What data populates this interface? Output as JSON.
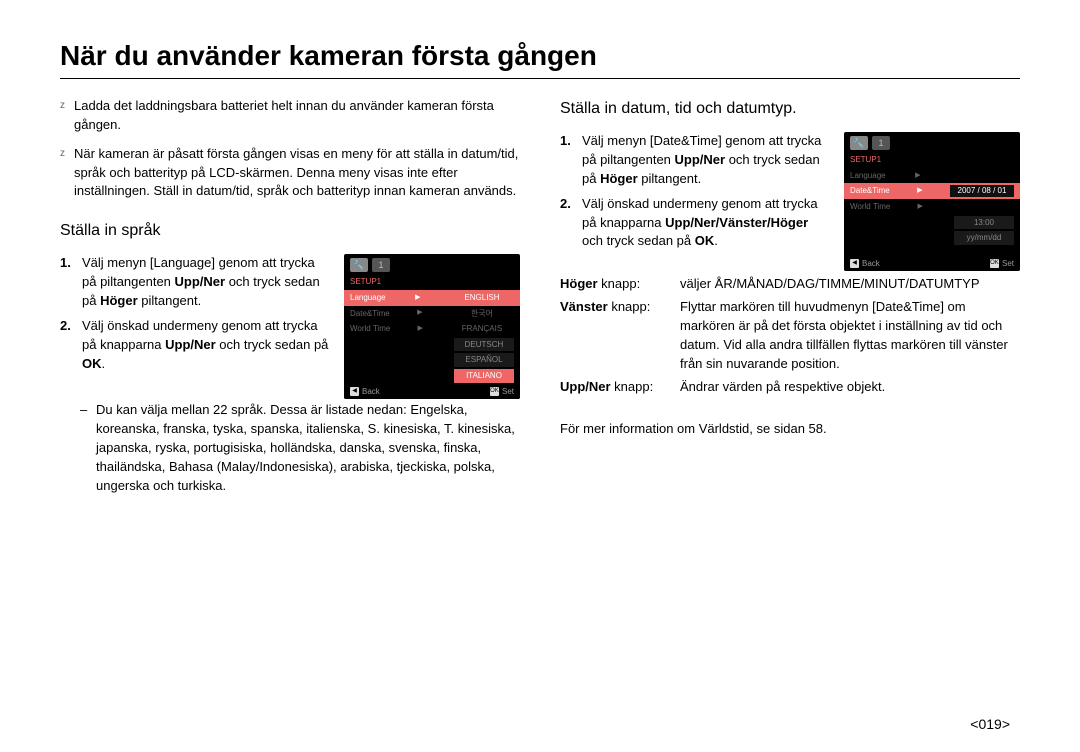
{
  "title": "När du använder kameran första gången",
  "left": {
    "leads": [
      "Ladda det laddningsbara batteriet helt innan du använder kameran första gången.",
      "När kameran är påsatt första gången visas en meny för att ställa in datum/tid, språk och batterityp på LCD-skärmen. Denna meny visas inte efter inställningen. Ställ in datum/tid, språk och batterityp innan kameran används."
    ],
    "h2": "Ställa in språk",
    "step1_a": "Välj menyn [Language] genom att trycka på piltangenten ",
    "step1_b": "Upp/Ner",
    "step1_c": " och tryck sedan på ",
    "step1_d": "Höger",
    "step1_e": " piltangent.",
    "step2_a": "Välj önskad undermeny genom att trycka på knapparna ",
    "step2_b": "Upp/Ner",
    "step2_c": " och tryck sedan på ",
    "step2_d": "OK",
    "step2_e": ".",
    "sub_a": "Du kan välja mellan 22 språk. Dessa är listade nedan: Engelska, koreanska, franska, tyska, spanska, italienska, S. kinesiska, T. kinesiska, japanska, ryska, portugisiska, holländska, danska, svenska, finska, thailändska, Bahasa (Malay/Indonesiska), arabiska, tjeckiska, polska, ungerska och turkiska.",
    "lcd": {
      "setup": "SETUP1",
      "r1_l": "Language",
      "r1_v": "ENGLISH",
      "r2_l": "Date&Time",
      "r2_v": "한국어",
      "r3_l": "World Time",
      "r3_v": "FRANÇAIS",
      "opt4": "DEUTSCH",
      "opt5": "ESPAÑOL",
      "opt6": "ITALIANO",
      "back": "Back",
      "ok": "OK",
      "set": "Set"
    }
  },
  "right": {
    "h2": "Ställa in datum, tid och datumtyp.",
    "step1_a": "Välj menyn [Date&Time] genom att trycka på piltangenten ",
    "step1_b": "Upp/Ner",
    "step1_c": " och tryck sedan på ",
    "step1_d": "Höger",
    "step1_e": " piltangent.",
    "step2_a": "Välj önskad undermeny genom att trycka på knapparna ",
    "step2_b": "Upp/Ner/Vänster/Höger",
    "step2_c": " och tryck sedan på ",
    "step2_d": "OK",
    "step2_e": ".",
    "kv1_k": "Höger",
    "kv1_k2": " knapp:",
    "kv1_v": "väljer ÅR/MÅNAD/DAG/TIMME/MINUT/DATUMTYP",
    "kv2_k": "Vänster",
    "kv2_k2": " knapp:",
    "kv2_v": "Flyttar markören till huvudmenyn [Date&Time] om markören är på det första objektet i inställning av tid och datum. Vid alla andra tillfällen flyttas markören till vänster från sin nuvarande position.",
    "kv3_k": "Upp/Ner",
    "kv3_k2": " knapp:",
    "kv3_v": "Ändrar värden på respektive objekt.",
    "note": "För mer information om Världstid, se sidan 58.",
    "lcd": {
      "setup": "SETUP1",
      "r1_l": "Language",
      "r2_l": "Date&Time",
      "r2_v": "2007 / 08 / 01",
      "r3_l": "World Time",
      "time": "13:00",
      "fmt": "yy/mm/dd",
      "back": "Back",
      "ok": "OK",
      "set": "Set"
    }
  },
  "pagenum": "<019>"
}
